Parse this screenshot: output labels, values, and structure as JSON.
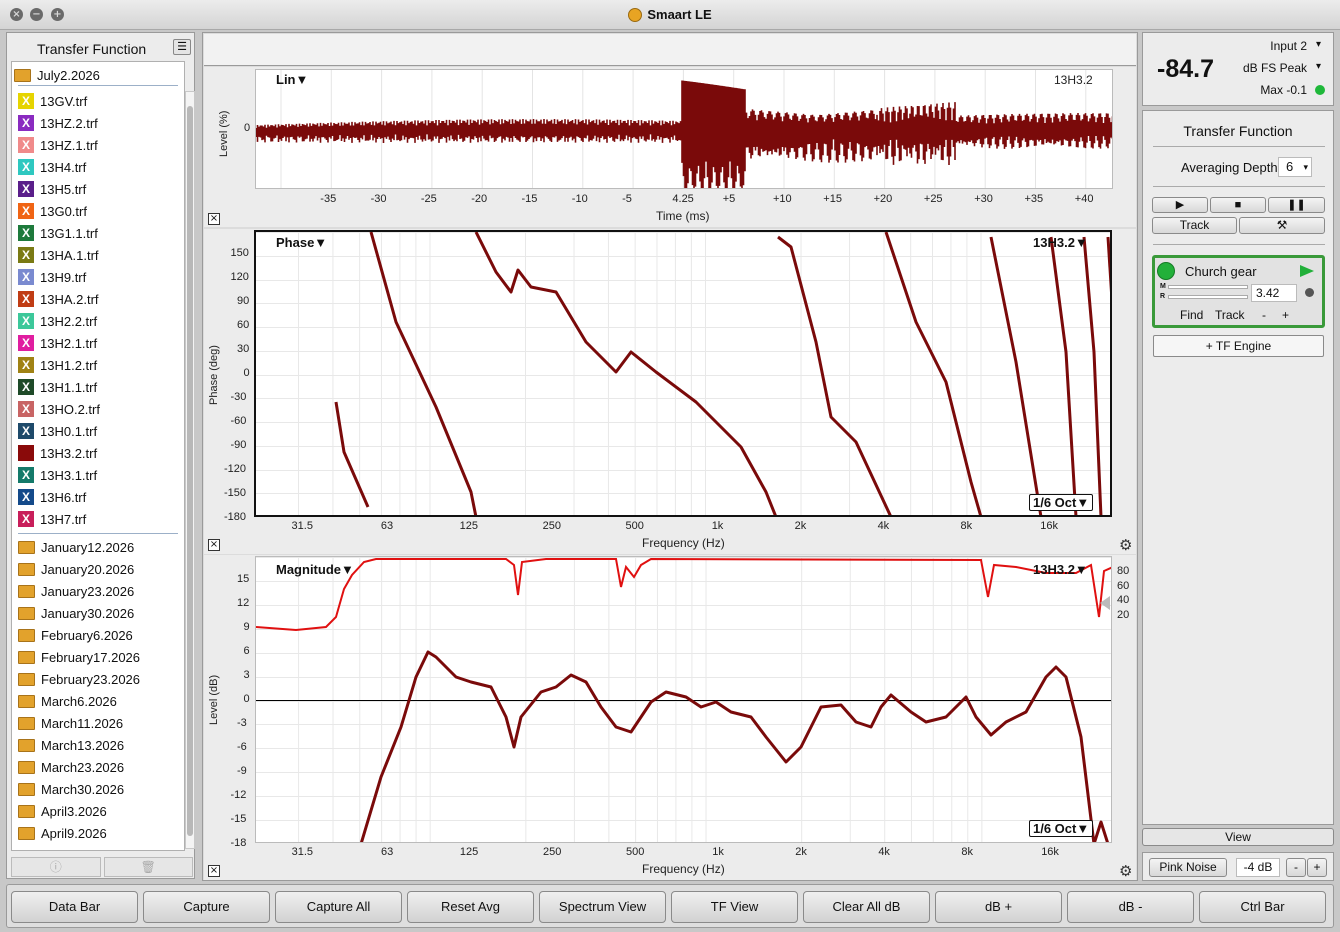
{
  "window": {
    "title": "Smaart LE"
  },
  "sidebar": {
    "title": "Transfer Function",
    "open_folder": "July2.2026",
    "files": [
      {
        "name": "13GV.trf",
        "color": "#e6d400"
      },
      {
        "name": "13HZ.2.trf",
        "color": "#8a2bc0"
      },
      {
        "name": "13HZ.1.trf",
        "color": "#f08a8a"
      },
      {
        "name": "13H4.trf",
        "color": "#2ec8c0"
      },
      {
        "name": "13H5.trf",
        "color": "#5a1e8a"
      },
      {
        "name": "13G0.trf",
        "color": "#f06414"
      },
      {
        "name": "13G1.1.trf",
        "color": "#1e7a3c"
      },
      {
        "name": "13HA.1.trf",
        "color": "#7a7a14"
      },
      {
        "name": "13H9.trf",
        "color": "#7a8ad0"
      },
      {
        "name": "13HA.2.trf",
        "color": "#c03c14"
      },
      {
        "name": "13H2.2.trf",
        "color": "#3cc89a"
      },
      {
        "name": "13H2.1.trf",
        "color": "#e01ea0"
      },
      {
        "name": "13H1.2.trf",
        "color": "#a08214"
      },
      {
        "name": "13H1.1.trf",
        "color": "#1e4a28"
      },
      {
        "name": "13HO.2.trf",
        "color": "#c86464"
      },
      {
        "name": "13H0.1.trf",
        "color": "#1e4a6a"
      },
      {
        "name": "13H3.2.trf",
        "color": "#8a0a0a"
      },
      {
        "name": "13H3.1.trf",
        "color": "#147a6a"
      },
      {
        "name": "13H6.trf",
        "color": "#144a8a"
      },
      {
        "name": "13H7.trf",
        "color": "#c81e5a"
      }
    ],
    "folders": [
      "January12.2026",
      "January20.2026",
      "January23.2026",
      "January30.2026",
      "February6.2026",
      "February17.2026",
      "February23.2026",
      "March6.2026",
      "March11.2026",
      "March13.2026",
      "March23.2026",
      "March30.2026",
      "April3.2026",
      "April9.2026"
    ],
    "info_icon": "info-icon",
    "trash_icon": "trash-icon"
  },
  "impulse": {
    "mode": "Lin▼",
    "trace": "13H3.2",
    "ylabel": "Level (%)",
    "ytick": "0",
    "xlabel": "Time (ms)",
    "xticks": [
      "-35",
      "-30",
      "-25",
      "-20",
      "-15",
      "-10",
      "-5",
      "4.25",
      "+5",
      "+10",
      "+15",
      "+20",
      "+25",
      "+30",
      "+35",
      "+40"
    ]
  },
  "phase": {
    "label": "Phase▼",
    "trace": "13H3.2▼",
    "ylabel": "Phase (deg)",
    "yticks": [
      "150",
      "120",
      "90",
      "60",
      "30",
      "0",
      "-30",
      "-60",
      "-90",
      "-120",
      "-150",
      "-180"
    ],
    "xlabel": "Frequency (Hz)",
    "xticks": [
      "31.5",
      "63",
      "125",
      "250",
      "500",
      "1k",
      "2k",
      "4k",
      "8k",
      "16k"
    ],
    "smoothing": "1/6 Oct▼"
  },
  "magnitude": {
    "label": "Magnitude▼",
    "trace": "13H3.2▼",
    "ylabel": "Level (dB)",
    "yticks": [
      "15",
      "12",
      "9",
      "6",
      "3",
      "0",
      "-3",
      "-6",
      "-9",
      "-12",
      "-15",
      "-18"
    ],
    "coh_ticks": [
      "80",
      "60",
      "40",
      "20"
    ],
    "xlabel": "Frequency (Hz)",
    "xticks": [
      "31.5",
      "63",
      "125",
      "250",
      "500",
      "1k",
      "2k",
      "4k",
      "8k",
      "16k"
    ],
    "smoothing": "1/6 Oct▼"
  },
  "meter": {
    "value": "-84.7",
    "input": "Input 2",
    "mode": "dB FS Peak",
    "max": "Max -0.1",
    "status_color": "#1fb83a"
  },
  "tf_panel": {
    "title": "Transfer Function",
    "avg_label": "Averaging Depth:",
    "avg_value": "6",
    "track_label": "Track",
    "tools_icon": "tools-icon",
    "engine": {
      "name": "Church gear",
      "delay": "3.42",
      "find": "Find",
      "track": "Track",
      "minus": "-",
      "plus": "+",
      "m": "M",
      "r": "R"
    },
    "add_engine": "+ TF Engine"
  },
  "view_label": "View",
  "pink_noise": {
    "label": "Pink Noise",
    "level": "-4 dB",
    "minus": "-",
    "plus": "+"
  },
  "bottom_buttons": [
    "Data Bar",
    "Capture",
    "Capture All",
    "Reset Avg",
    "Spectrum View",
    "TF View",
    "Clear All dB",
    "dB +",
    "dB -",
    "Ctrl Bar"
  ]
}
